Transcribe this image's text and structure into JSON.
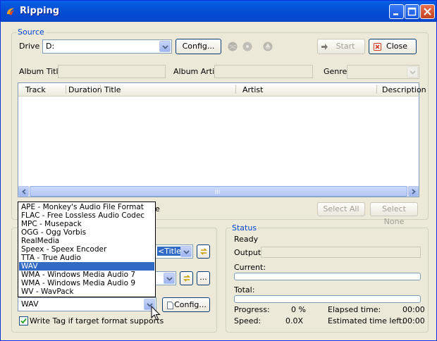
{
  "window": {
    "title": "Ripping",
    "colors": {
      "title_bar": "#0450d6",
      "accent": "#0046d5",
      "selection": "#316ac5"
    }
  },
  "source": {
    "group_label": "Source",
    "drive_label": "Drive :",
    "drive_value": "D:",
    "config_label": "Config...",
    "start_label": "Start",
    "close_label": "Close",
    "album_title_label": "Album Title:",
    "album_artist_label": "Album Artist:",
    "genre_label": "Genre:",
    "columns": [
      "Track",
      "Duration",
      "Title",
      "Artist",
      "Description"
    ],
    "select_all_label": "Select All",
    "select_none_label": "Select None",
    "partial_text": "e"
  },
  "output": {
    "format_options": [
      "APE - Monkey's Audio File Format",
      "FLAC - Free Lossless Audio Codec",
      "MPC - Musepack",
      "OGG - Ogg Vorbis",
      "RealMedia",
      "Speex - Speex Encoder",
      "TTA - True Audio",
      "WAV",
      "WMA - Windows Media Audio 7",
      "WMA - Windows Media Audio 9",
      "WV - WavPack"
    ],
    "highlighted_option": "WAV",
    "filename_pattern_partial": "<Title>",
    "format_value": "WAV",
    "config_label": "Config...",
    "browse_label": "...",
    "write_tag_label": "Write Tag if target format supports",
    "write_tag_checked": true
  },
  "status": {
    "group_label": "Status",
    "state": "Ready",
    "output_label": "Output:",
    "current_label": "Current:",
    "total_label": "Total:",
    "progress_label": "Progress:",
    "progress_value": "0 %",
    "speed_label": "Speed:",
    "speed_value": "0.0X",
    "elapsed_label": "Elapsed time:",
    "elapsed_value": "00:00",
    "estimated_label": "Estimated time left:",
    "estimated_value": "00:00"
  }
}
